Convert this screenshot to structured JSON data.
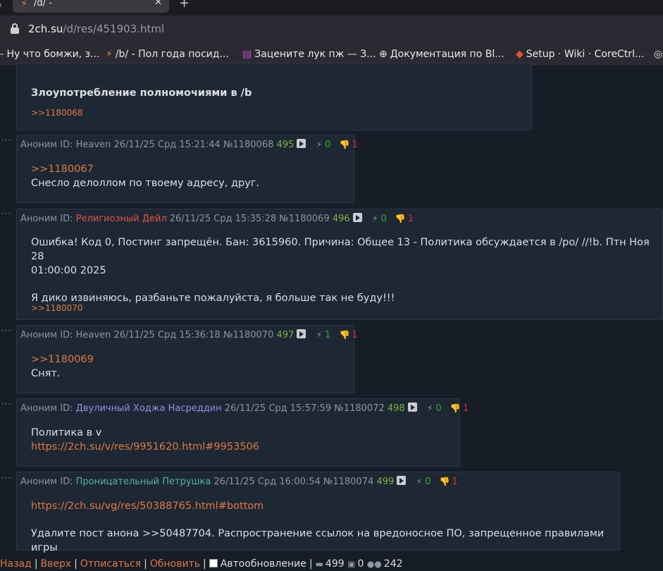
{
  "browser": {
    "tab_title": "/d/ -",
    "url_host": "2ch.su",
    "url_path": "/d/res/451903.html",
    "bookmarks": [
      {
        "label": "- Ну что бомжи, з..."
      },
      {
        "label": "/b/ - Пол года посид..."
      },
      {
        "label": "Зацените лук пж — З..."
      },
      {
        "label": "Документация по Bl..."
      },
      {
        "label": "Setup · Wiki · CoreCtrl..."
      }
    ]
  },
  "posts": [
    {
      "body_bold": "Злоупотребление полномочиями в /b",
      "backlink": ">>1180068"
    },
    {
      "name": "Аноним",
      "id_label": "ID:",
      "id": "Heaven",
      "date": "26/11/25 Срд 15:21:44",
      "num": "№1180068",
      "count": "495",
      "likes": "0",
      "dislikes": "1",
      "reply": ">>1180067",
      "text": "Снесло делоллом по твоему адресу, друг."
    },
    {
      "name": "Аноним",
      "id_label": "ID:",
      "id": "Религиозный Дейл",
      "date": "26/11/25 Срд 15:35:28",
      "num": "№1180069",
      "count": "496",
      "likes": "0",
      "dislikes": "1",
      "text1": "Ошибка! Код 0, Постинг запрещён. Бан: 3615960. Причина: Общее 13 - Политика обсуждается в /po/ //!b. Птн Ноя 28",
      "text2": "01:00:00 2025",
      "text3": "Я дико извиняюсь, разбаньте пожалуйста, я больше так не буду!!!",
      "backlink": ">>1180070"
    },
    {
      "name": "Аноним",
      "id_label": "ID:",
      "id": "Heaven",
      "date": "26/11/25 Срд 15:36:18",
      "num": "№1180070",
      "count": "497",
      "likes": "1",
      "dislikes": "1",
      "reply": ">>1180069",
      "text": "Снят."
    },
    {
      "name": "Аноним",
      "id_label": "ID:",
      "id": "Двуличный Ходжа Насреддин",
      "date": "26/11/25 Срд 15:57:59",
      "num": "№1180072",
      "count": "498",
      "likes": "0",
      "dislikes": "1",
      "text": "Политика в v",
      "link": "https://2ch.su/v/res/9951620.html#9953506"
    },
    {
      "name": "Аноним",
      "id_label": "ID:",
      "id": "Проницательный Петрушка",
      "date": "26/11/25 Срд 16:00:54",
      "num": "№1180074",
      "count": "499",
      "likes": "0",
      "dislikes": "1",
      "link": "https://2ch.su/vg/res/50388765.html#bottom",
      "text": "Удалите пост анона >>50487704. Распространение ссылок на вредоносное ПО, запрещенное правилами игры"
    }
  ],
  "footer": {
    "back": "Назад",
    "top": "Вверх",
    "unsubscribe": "Отписаться",
    "refresh": "Обновить",
    "autorefresh": "Автообновление",
    "posts_count": "499",
    "images_count": "0",
    "users_count": "242"
  },
  "colors": {
    "accent_link": "#e0793f",
    "like_green": "#3ba53b",
    "dislike_red": "#d32f2f",
    "post_count_green": "#7cb342"
  }
}
